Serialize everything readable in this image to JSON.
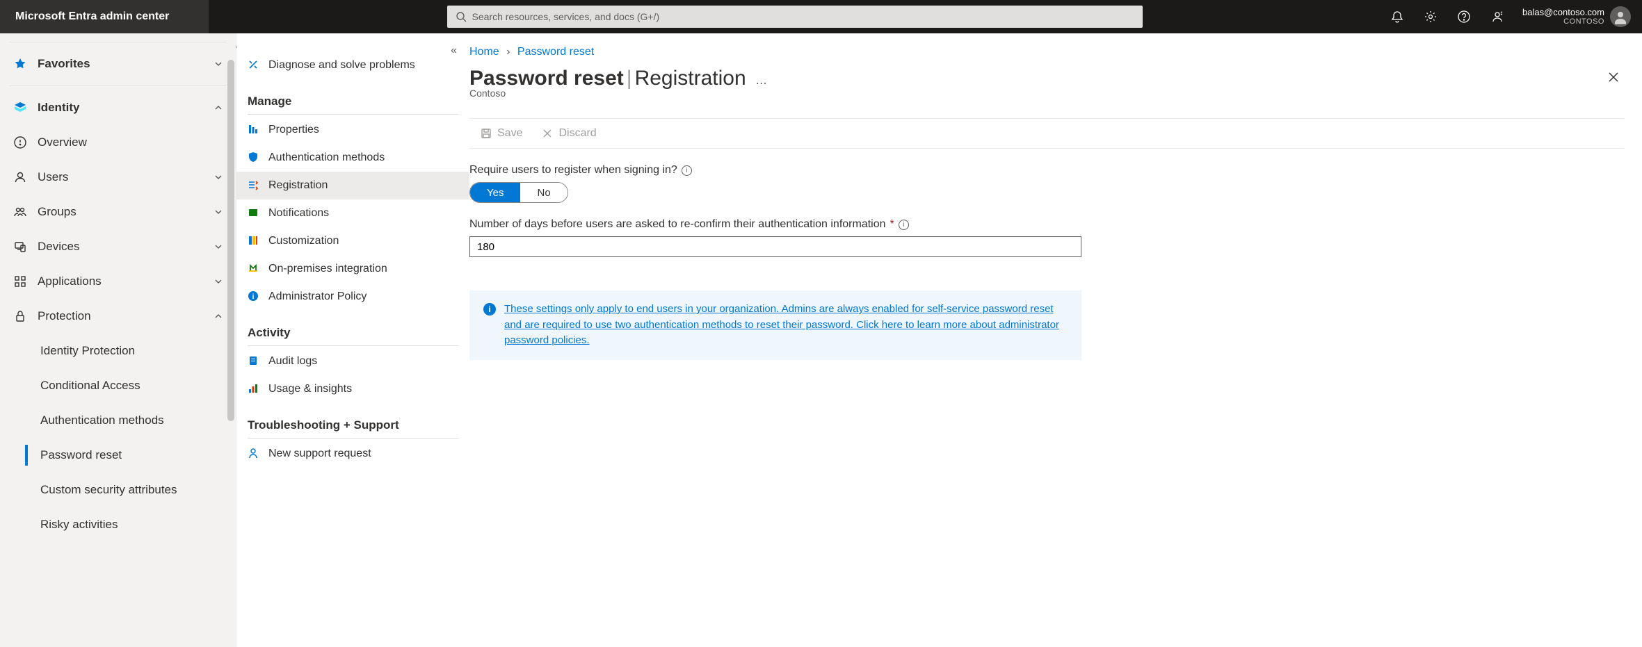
{
  "header": {
    "brand": "Microsoft Entra admin center",
    "search_placeholder": "Search resources, services, and docs (G+/)",
    "user_email": "balas@contoso.com",
    "tenant": "CONTOSO"
  },
  "sidebar": {
    "favorites": "Favorites",
    "identity": "Identity",
    "overview": "Overview",
    "users": "Users",
    "groups": "Groups",
    "devices": "Devices",
    "applications": "Applications",
    "protection": "Protection",
    "sub": {
      "identity_protection": "Identity Protection",
      "conditional_access": "Conditional Access",
      "auth_methods": "Authentication methods",
      "password_reset": "Password reset",
      "custom_sec": "Custom security attributes",
      "risky": "Risky activities"
    }
  },
  "blade": {
    "diagnose": "Diagnose and solve problems",
    "manage": "Manage",
    "properties": "Properties",
    "auth_methods": "Authentication methods",
    "registration": "Registration",
    "notifications": "Notifications",
    "customization": "Customization",
    "onprem": "On-premises integration",
    "admin_policy": "Administrator Policy",
    "activity": "Activity",
    "audit": "Audit logs",
    "usage": "Usage & insights",
    "trouble": "Troubleshooting + Support",
    "support": "New support request"
  },
  "breadcrumb": {
    "home": "Home",
    "pr": "Password reset"
  },
  "page": {
    "title_bold": "Password reset",
    "title_thin": "Registration",
    "tenant": "Contoso",
    "save": "Save",
    "discard": "Discard"
  },
  "form": {
    "require_label": "Require users to register when signing in?",
    "yes": "Yes",
    "no": "No",
    "days_label": "Number of days before users are asked to re-confirm their authentication information",
    "days_value": "180",
    "banner": "These settings only apply to end users in your organization. Admins are always enabled for self-service password reset and are required to use two authentication methods to reset their password. Click here to learn more about administrator password policies."
  }
}
